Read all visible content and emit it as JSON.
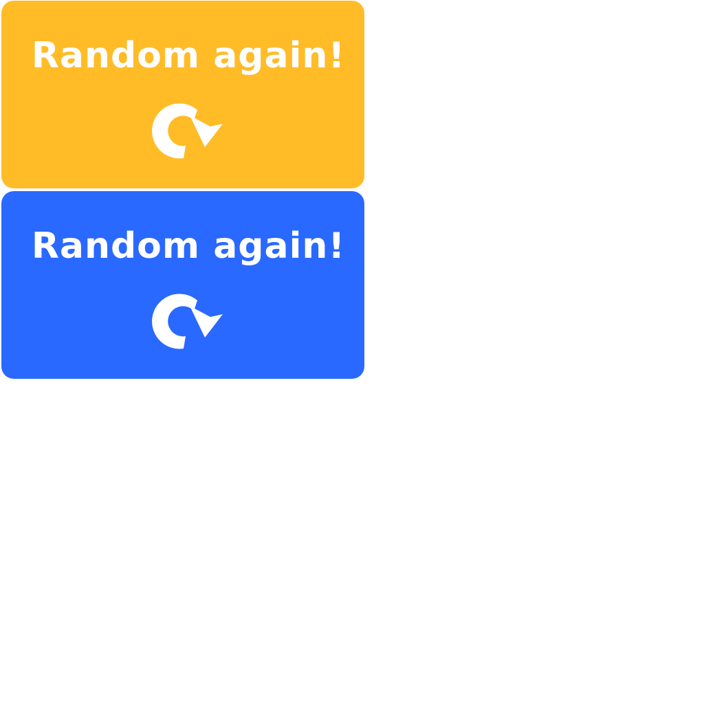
{
  "buttons": [
    {
      "label": "Random again!",
      "icon": "refresh-icon",
      "color": "#FFBC27"
    },
    {
      "label": "Random again!",
      "icon": "refresh-icon",
      "color": "#2A69FF"
    }
  ],
  "icon_color": "#FFFFFF",
  "background": "#FFFFFF"
}
